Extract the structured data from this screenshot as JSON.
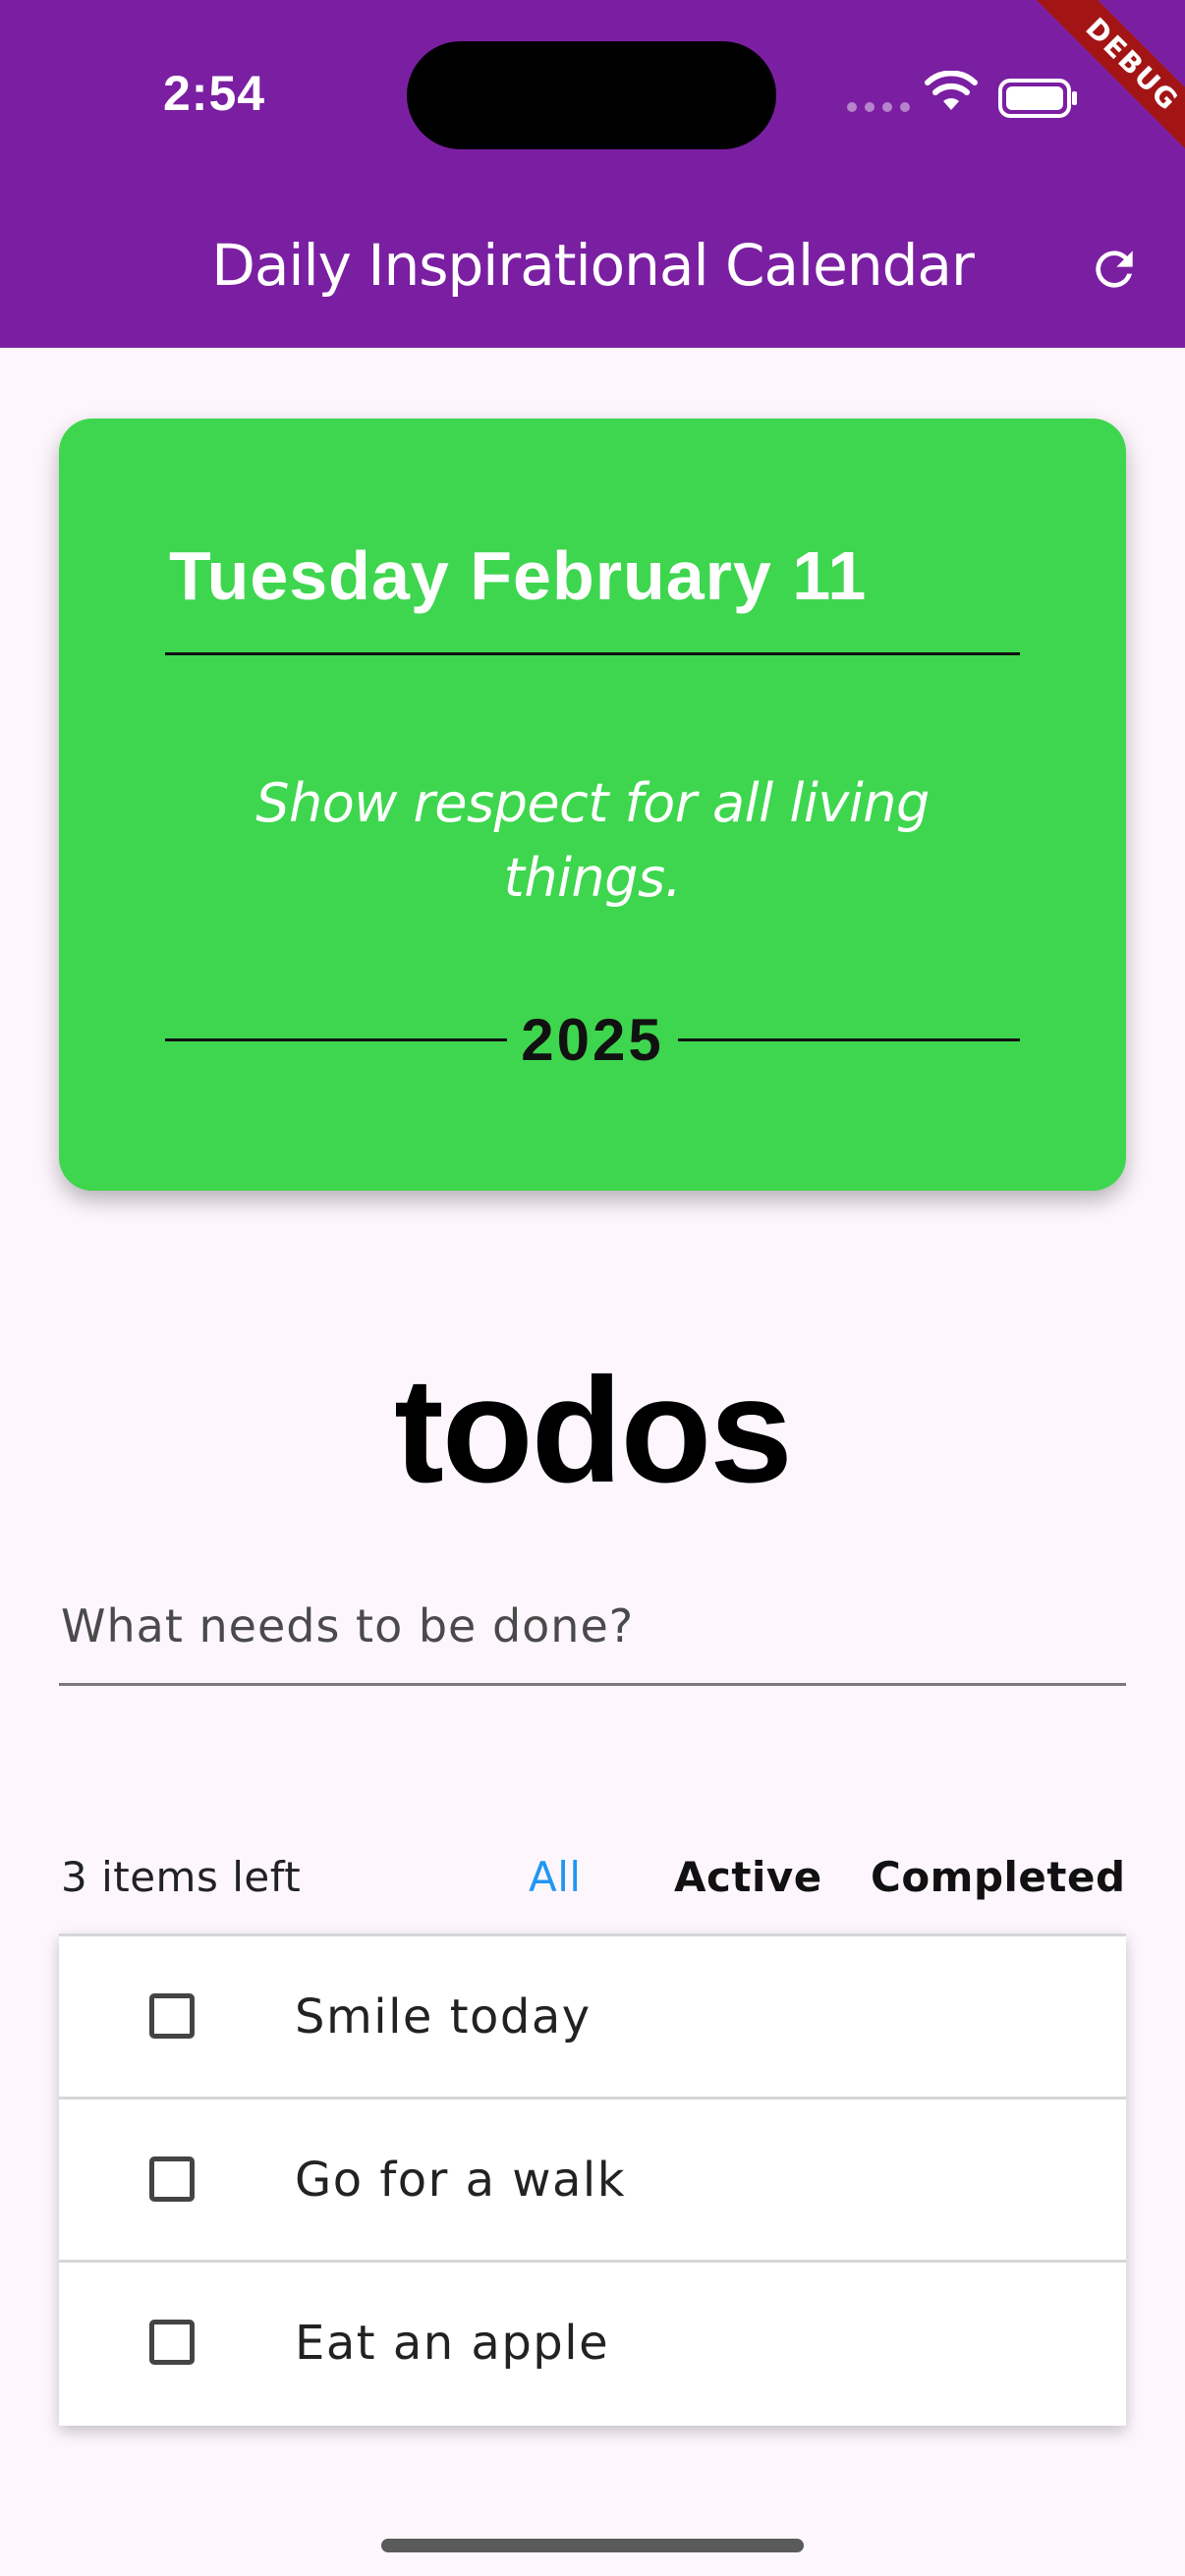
{
  "status_bar": {
    "time": "2:54"
  },
  "debug_banner": "DEBUG",
  "app_bar": {
    "title": "Daily Inspirational Calendar",
    "background_color": "#7b1fa2",
    "refresh_icon": "refresh-icon"
  },
  "calendar_card": {
    "date": "Tuesday February 11",
    "quote": "Show respect for all living things.",
    "year": "2025",
    "background_color": "#3ed64e"
  },
  "todos": {
    "title": "todos",
    "input_placeholder": "What needs to be done?",
    "items_left": "3 items left",
    "filters": [
      {
        "label": "All",
        "selected": true
      },
      {
        "label": "Active",
        "selected": false
      },
      {
        "label": "Completed",
        "selected": false
      }
    ],
    "items": [
      {
        "text": "Smile today",
        "completed": false
      },
      {
        "text": "Go for a walk",
        "completed": false
      },
      {
        "text": "Eat an apple",
        "completed": false
      }
    ],
    "accent_color": "#2196f3"
  }
}
